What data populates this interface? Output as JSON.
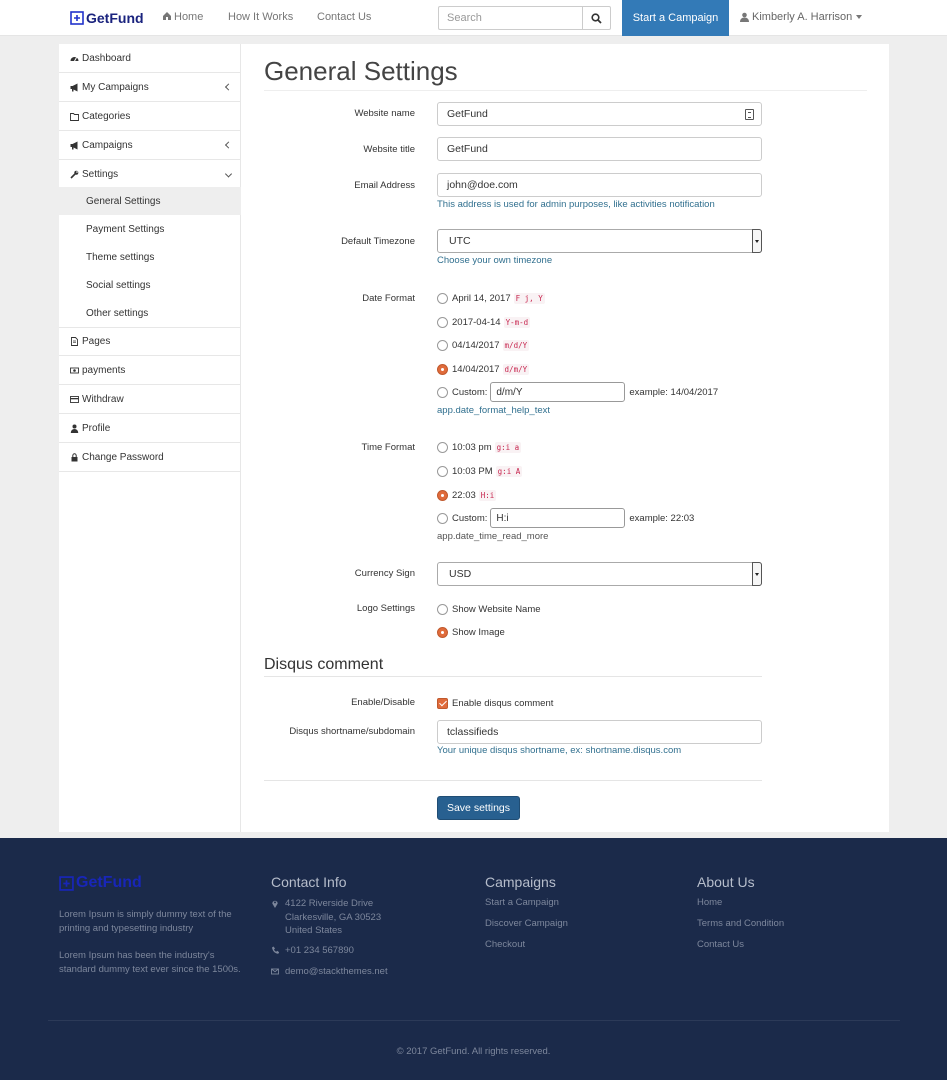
{
  "nav": {
    "brand": "GetFund",
    "home": "Home",
    "how_it_works": "How It Works",
    "contact_us": "Contact Us",
    "search_placeholder": "Search",
    "start_campaign": "Start a Campaign",
    "user_name": "Kimberly A. Harrison"
  },
  "sidebar": {
    "items": [
      {
        "label": "Dashboard"
      },
      {
        "label": "My Campaigns"
      },
      {
        "label": "Categories"
      },
      {
        "label": "Campaigns"
      },
      {
        "label": "Settings"
      }
    ],
    "sub_items": [
      {
        "label": "General Settings"
      },
      {
        "label": "Payment Settings"
      },
      {
        "label": "Theme settings"
      },
      {
        "label": "Social settings"
      },
      {
        "label": "Other settings"
      }
    ],
    "bottom_items": [
      {
        "label": "Pages"
      },
      {
        "label": "payments"
      },
      {
        "label": "Withdraw"
      },
      {
        "label": "Profile"
      },
      {
        "label": "Change Password"
      }
    ]
  },
  "form": {
    "title": "General Settings",
    "website_name_label": "Website name",
    "website_name_value": "GetFund",
    "website_title_label": "Website title",
    "website_title_value": "GetFund",
    "email_label": "Email Address",
    "email_value": "john@doe.com",
    "email_help": "This address is used for admin purposes, like activities notification",
    "timezone_label": "Default Timezone",
    "timezone_value": "UTC",
    "timezone_help": "Choose your own timezone",
    "date_format_label": "Date Format",
    "date_options": [
      {
        "text": "April 14, 2017",
        "code": "F j, Y"
      },
      {
        "text": "2017-04-14",
        "code": "Y-m-d"
      },
      {
        "text": "04/14/2017",
        "code": "m/d/Y"
      },
      {
        "text": "14/04/2017",
        "code": "d/m/Y"
      }
    ],
    "date_custom_label": "Custom:",
    "date_custom_value": "d/m/Y",
    "date_custom_example": "example: 14/04/2017",
    "date_help": "app.date_format_help_text",
    "time_format_label": "Time Format",
    "time_options": [
      {
        "text": "10:03 pm",
        "code": "g:i a"
      },
      {
        "text": "10:03 PM",
        "code": "g:i A"
      },
      {
        "text": "22:03",
        "code": "H:i"
      }
    ],
    "time_custom_label": "Custom:",
    "time_custom_value": "H:i",
    "time_custom_example": "example: 22:03",
    "time_help": "app.date_time_read_more",
    "currency_label": "Currency Sign",
    "currency_value": "USD",
    "logo_label": "Logo Settings",
    "logo_options": [
      "Show Website Name",
      "Show Image"
    ],
    "disqus_title": "Disqus comment",
    "enable_label": "Enable/Disable",
    "enable_text": "Enable disqus comment",
    "shortname_label": "Disqus shortname/subdomain",
    "shortname_value": "tclassifieds",
    "shortname_help": "Your unique disqus shortname, ex: shortname.disqus.com",
    "save": "Save settings"
  },
  "footer": {
    "brand": "GetFund",
    "about_1": "Lorem Ipsum is simply dummy text of the printing and typesetting industry",
    "about_2": "Lorem Ipsum has been the industry's standard dummy text ever since the 1500s.",
    "contact_title": "Contact Info",
    "address": [
      "4122 Riverside Drive",
      "Clarkesville, GA 30523",
      "United States"
    ],
    "phone": "+01 234 567890",
    "email": "demo@stackthemes.net",
    "campaigns_title": "Campaigns",
    "campaign_links": [
      "Start a Campaign",
      "Discover Campaign",
      "Checkout"
    ],
    "about_title": "About Us",
    "about_links": [
      "Home",
      "Terms and Condition",
      "Contact Us"
    ],
    "copyright": "© 2017 GetFund. All rights reserved."
  },
  "colors": {
    "primary": "#337ab7",
    "accent_radio": "#e06b3b",
    "footer_bg": "#1b2a4a",
    "brand": "#1a237e"
  }
}
